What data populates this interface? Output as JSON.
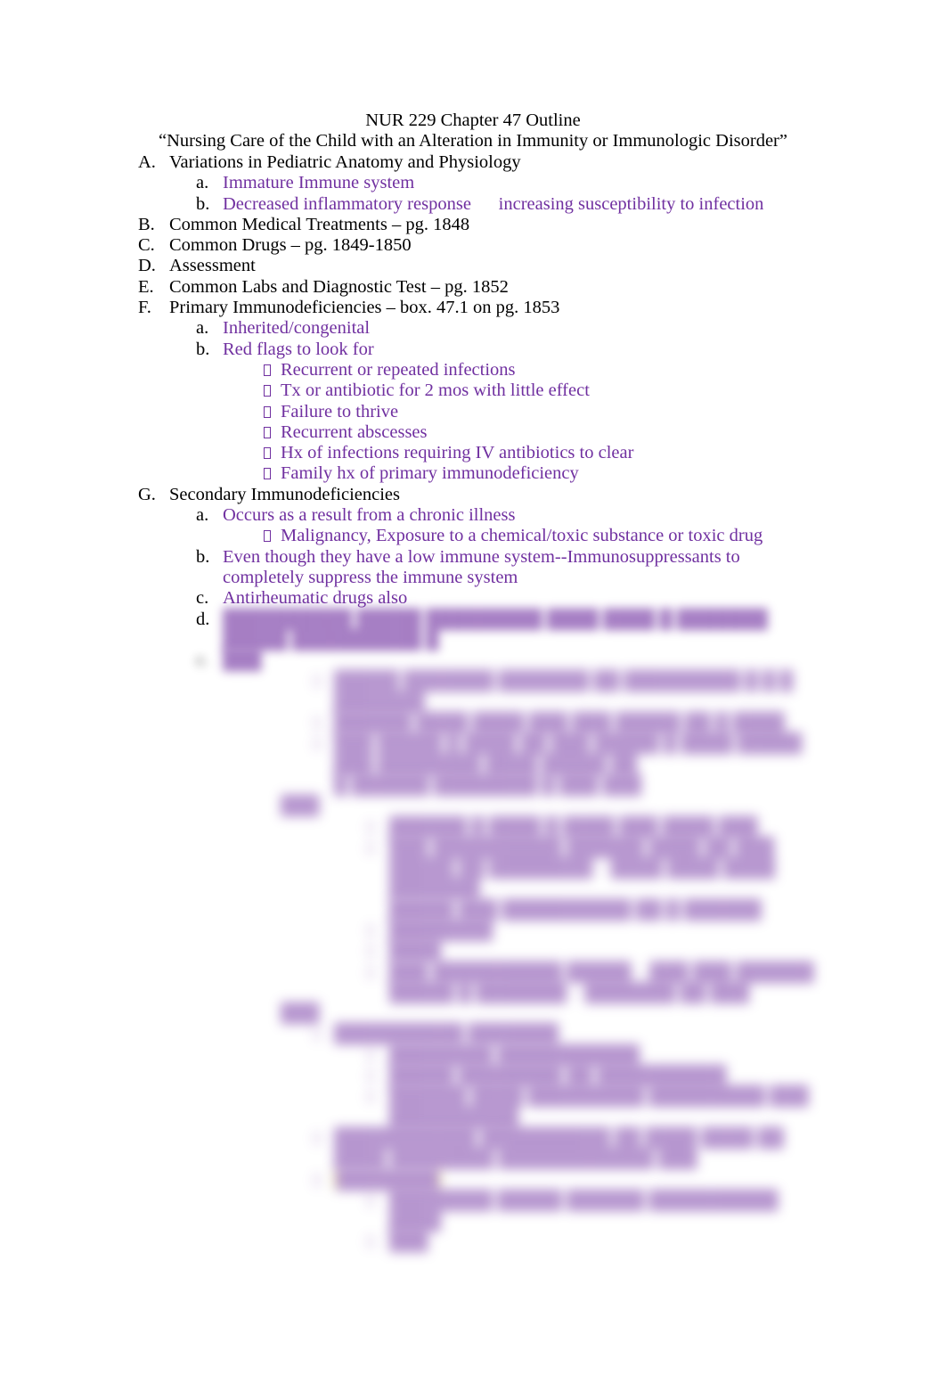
{
  "document": {
    "title": "NUR 229 Chapter 47 Outline",
    "subtitle": "“Nursing Care of the Child with an Alteration in Immunity or Immunologic Disorder”",
    "body_text_color": "#000000",
    "accent_text_color": "#7030a0",
    "highlight_color": "#ffff00",
    "page_background": "#ffffff",
    "bullet_glyph_name": "missing-glyph-box"
  },
  "outline": {
    "A": {
      "marker": "A.",
      "text": "Variations in Pediatric Anatomy and Physiology",
      "children": [
        {
          "marker": "a.",
          "text": "Immature Immune system"
        },
        {
          "marker": "b.",
          "text": "Decreased inflammatory response   increasing susceptibility to infection"
        }
      ]
    },
    "B": {
      "marker": "B.",
      "text": "Common Medical Treatments – pg. 1848"
    },
    "C": {
      "marker": "C.",
      "text": "Common Drugs – pg. 1849-1850"
    },
    "D": {
      "marker": "D.",
      "text": "Assessment"
    },
    "E": {
      "marker": "E.",
      "text": "Common Labs and Diagnostic Test – pg. 1852"
    },
    "F": {
      "marker": "F.",
      "text": "Primary Immunodeficiencies – box. 47.1 on pg. 1853",
      "children": [
        {
          "marker": "a.",
          "text": "Inherited/congenital"
        },
        {
          "marker": "b.",
          "text": "Red flags to look for",
          "children": [
            {
              "text": "Recurrent or repeated infections"
            },
            {
              "text": "Tx or antibiotic for 2 mos with little effect"
            },
            {
              "text": "Failure to thrive"
            },
            {
              "text": "Recurrent abscesses"
            },
            {
              "text": "Hx of infections requiring IV antibiotics to clear"
            },
            {
              "text": "Family hx of primary immunodeficiency"
            }
          ]
        }
      ]
    },
    "G": {
      "marker": "G.",
      "text": "Secondary Immunodeficiencies",
      "children": [
        {
          "marker": "a.",
          "text": "Occurs as a result from a chronic illness",
          "children": [
            {
              "text": "Malignancy, Exposure to a chemical/toxic substance or toxic drug"
            }
          ]
        },
        {
          "marker": "b.",
          "text": "Even though they have a low immune system--Immunosuppressants to completely suppress the immune system"
        },
        {
          "marker": "c.",
          "text": "Antirheumatic drugs also"
        },
        {
          "marker": "d.",
          "text": ""
        },
        {
          "marker": "e.",
          "text": ""
        }
      ]
    }
  },
  "redacted": {
    "note": "Lower portion of the page is blurred out in the source screenshot and is not legible.",
    "d_line": "██████████ █████ █████████ ████ ████ █ ███████ █████ ██████████ █",
    "e_line": "███",
    "block1": [
      "█████ ███████ ███████ ██ █████████ █ █ █ ███████",
      "██████ ████ ████ ███ ███ █████ ██ █ ████",
      "███ █████ █ ████ ██ ███ █████ █ ████ █████ ███ ████████ ████ █████ ██",
      "█ ██████ ████████ █ ███ ███"
    ],
    "block1_marker": "███",
    "block2": [
      "██████ █ ████ █ ████ ███ ████ ███",
      "███ ██████████ ██████ ████ ██ ███ █████ ██ ████████ – ████ ████ ████ ███████",
      "█████ ███ ██████████ ██ █ ██████",
      "████████",
      "████",
      "███ ██████████ █████ – ███ ███ ██████",
      "█████ █ ███████ – ███████ ██ ███"
    ],
    "block2_marker": "███",
    "block3_marker": "███",
    "block3_heading": "██████████ ███████",
    "block3_items": [
      "████████ ███████████",
      "█████ ████████ ██ ██████████",
      "██████ ████ █████████ █████████ ███ ██████████"
    ],
    "block4_line": "███████████ ██████████ ██ ████ ████ ██ ████ ████████ ████████████ ███",
    "highlighted_text": "████████",
    "block5_line": "████████ █████ ██████ ██████████ ████",
    "block6_line": "███"
  }
}
